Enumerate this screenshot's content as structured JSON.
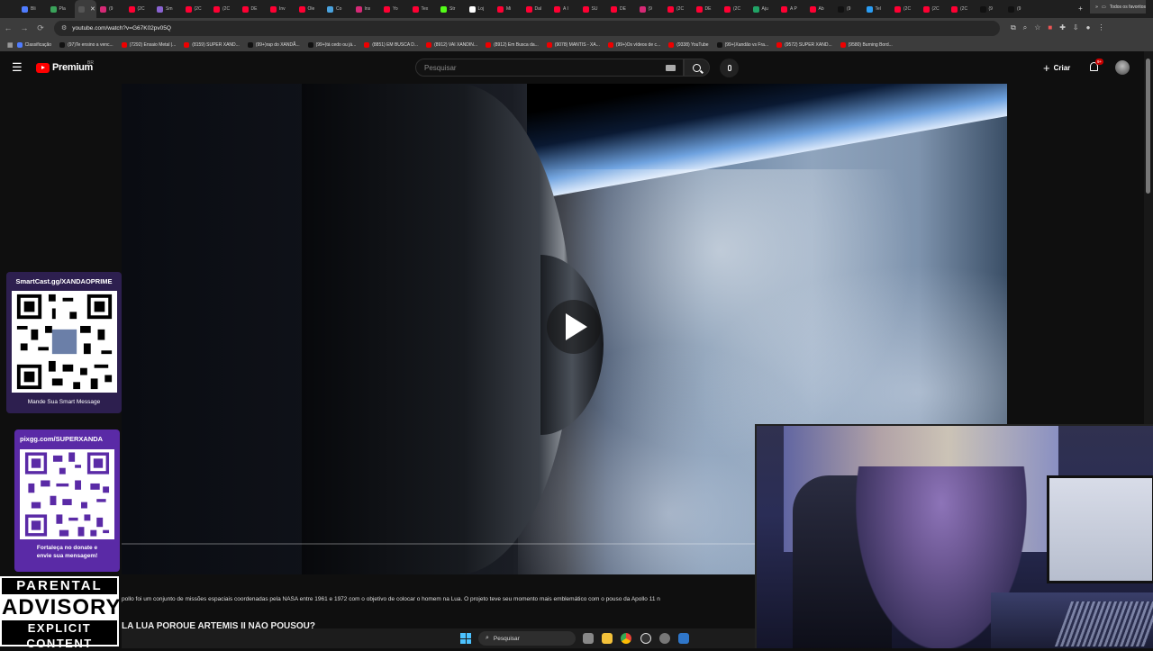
{
  "browser": {
    "tabs": [
      {
        "label": "Bli",
        "color": "#4f7cff"
      },
      {
        "label": "Pla",
        "color": "#3aa35a"
      },
      {
        "label": "",
        "color": "#555555",
        "active": true
      },
      {
        "label": "(9",
        "color": "#d62976"
      },
      {
        "label": "(2C",
        "color": "#ff0033"
      },
      {
        "label": "Sm",
        "color": "#8a63d2"
      },
      {
        "label": "(2C",
        "color": "#ff0033"
      },
      {
        "label": "(2C",
        "color": "#ff0033"
      },
      {
        "label": "DE",
        "color": "#ff0033"
      },
      {
        "label": "Inv",
        "color": "#ff0033"
      },
      {
        "label": "Ole",
        "color": "#ff0033"
      },
      {
        "label": "Co",
        "color": "#4aa3df"
      },
      {
        "label": "Ins",
        "color": "#d62976"
      },
      {
        "label": "Yo",
        "color": "#ff0033"
      },
      {
        "label": "Tex",
        "color": "#ff0033"
      },
      {
        "label": "Str",
        "color": "#53fc18"
      },
      {
        "label": "Loj",
        "color": "#ffffff"
      },
      {
        "label": "Mi",
        "color": "#ff0033"
      },
      {
        "label": "Dal",
        "color": "#ff0033"
      },
      {
        "label": "A I",
        "color": "#ff0033"
      },
      {
        "label": "SU",
        "color": "#ff0033"
      },
      {
        "label": "DE",
        "color": "#ff0033"
      },
      {
        "label": "(9",
        "color": "#d62976"
      },
      {
        "label": "(2C",
        "color": "#ff0033"
      },
      {
        "label": "DE",
        "color": "#ff0033"
      },
      {
        "label": "(2C",
        "color": "#ff0033"
      },
      {
        "label": "Aju",
        "color": "#21a366"
      },
      {
        "label": "A P",
        "color": "#ff0033"
      },
      {
        "label": "Ab",
        "color": "#ff0033"
      },
      {
        "label": "(9",
        "color": "#111111"
      },
      {
        "label": "Tel",
        "color": "#2a9df4"
      },
      {
        "label": "(2C",
        "color": "#ff0033"
      },
      {
        "label": "(2C",
        "color": "#ff0033"
      },
      {
        "label": "(2C",
        "color": "#ff0033"
      },
      {
        "label": "(9",
        "color": "#111111"
      },
      {
        "label": "(9",
        "color": "#111111"
      }
    ],
    "new_tab": "+",
    "window_controls": {
      "minimize": "–",
      "maximize": "❐",
      "close": "✕"
    },
    "url": "youtube.com/watch?v=G67K02pv05Q",
    "nav": {
      "back": "←",
      "forward": "→",
      "reload": "⟳"
    },
    "bookmarks": [
      "Classificação",
      "(97)Te ensino a venc...",
      "(7292) Ensaio Metal |...",
      "(8159) SUPER XAND...",
      "(99+)rap do XANDÃ...",
      "(99+)tá cedo ou já...",
      "(8851) EM BUSCA D...",
      "(8912) VAI XANDIN...",
      "(8912) Em Busca da...",
      "(9078) MANTIS - XA...",
      "(99+)Os vídeos de c...",
      "(9338) YouTube",
      "(99+)Xandão vs Fra...",
      "(9572) SUPER XAND...",
      "(9580) Burning Bord..."
    ],
    "bookmarks_more": "»",
    "all_bookmarks": "Todos os favoritos"
  },
  "youtube": {
    "logo_text": "Premium",
    "country": "BR",
    "search_placeholder": "Pesquisar",
    "create_label": "Criar",
    "notif_badge": "9+",
    "video_description": "pollo foi um conjunto de missões espaciais coordenadas pela NASA entre 1961 e 1972 com o objetivo de colocar o homem na Lua. O projeto teve seu momento mais emblemático com o pouso da Apollo 11 n",
    "video_title": "LA LUA PORQUE ARTEMIS II NÃO POUSOU?"
  },
  "overlays": {
    "qr1_header": "SmartCast.gg/XANDAOPRIME",
    "qr1_footer": "Mande Sua Smart Message",
    "qr2_header": "pixgg.com/SUPERXANDA",
    "qr2_footer_1": "Fortaleça no donate e",
    "qr2_footer_2": "envie sua mensagem!",
    "pa_line1": "PARENTAL",
    "pa_line2": "ADVISORY",
    "pa_line3": "EXPLICIT CONTENT"
  },
  "taskbar": {
    "search_label": "Pesquisar"
  }
}
